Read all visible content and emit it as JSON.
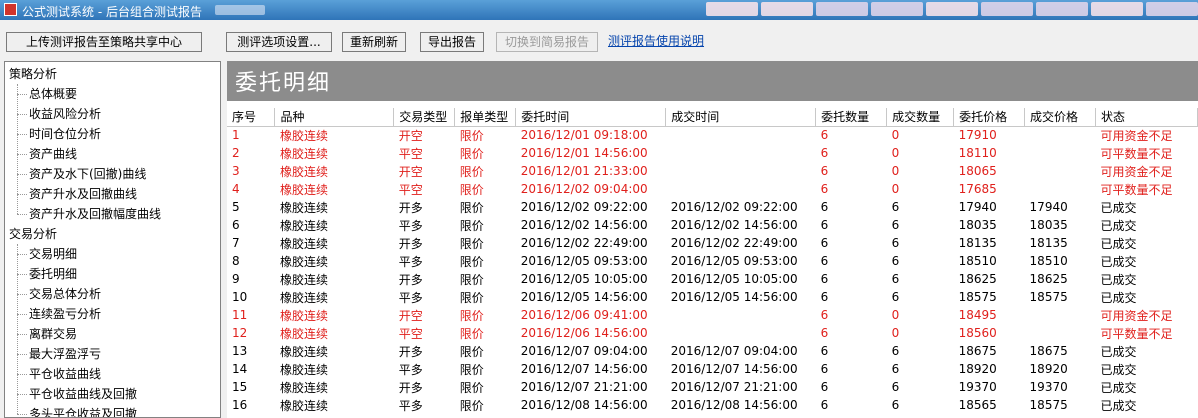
{
  "window": {
    "title": "公式测试系统 - 后台组合测试报告"
  },
  "toolbar": {
    "upload_label": "上传测评报告至策略共享中心",
    "options_label": "测评选项设置...",
    "refresh_label": "重新刷新",
    "export_label": "导出报告",
    "switch_label": "切换到简易报告",
    "help_link": "测评报告使用说明"
  },
  "sidebar": {
    "groups": [
      {
        "label": "策略分析",
        "items": [
          "总体概要",
          "收益风险分析",
          "时间仓位分析",
          "资产曲线",
          "资产及水下(回撤)曲线",
          "资产升水及回撤曲线",
          "资产升水及回撤幅度曲线"
        ]
      },
      {
        "label": "交易分析",
        "items": [
          "交易明细",
          "委托明细",
          "交易总体分析",
          "连续盈亏分析",
          "离群交易",
          "最大浮盈浮亏",
          "平仓收益曲线",
          "平仓收益曲线及回撤",
          "多头平仓收益及回撤"
        ]
      }
    ]
  },
  "main": {
    "heading": "委托明细",
    "columns": [
      "序号",
      "品种",
      "交易类型",
      "报单类型",
      "委托时间",
      "成交时间",
      "委托数量",
      "成交数量",
      "委托价格",
      "成交价格",
      "状态"
    ],
    "rows": [
      [
        "1",
        "橡胶连续",
        "开空",
        "限价",
        "2016/12/01 09:18:00",
        "",
        "6",
        "0",
        "17910",
        "",
        "可用资金不足"
      ],
      [
        "2",
        "橡胶连续",
        "平空",
        "限价",
        "2016/12/01 14:56:00",
        "",
        "6",
        "0",
        "18110",
        "",
        "可平数量不足"
      ],
      [
        "3",
        "橡胶连续",
        "开空",
        "限价",
        "2016/12/01 21:33:00",
        "",
        "6",
        "0",
        "18065",
        "",
        "可用资金不足"
      ],
      [
        "4",
        "橡胶连续",
        "平空",
        "限价",
        "2016/12/02 09:04:00",
        "",
        "6",
        "0",
        "17685",
        "",
        "可平数量不足"
      ],
      [
        "5",
        "橡胶连续",
        "开多",
        "限价",
        "2016/12/02 09:22:00",
        "2016/12/02 09:22:00",
        "6",
        "6",
        "17940",
        "17940",
        "已成交"
      ],
      [
        "6",
        "橡胶连续",
        "平多",
        "限价",
        "2016/12/02 14:56:00",
        "2016/12/02 14:56:00",
        "6",
        "6",
        "18035",
        "18035",
        "已成交"
      ],
      [
        "7",
        "橡胶连续",
        "开多",
        "限价",
        "2016/12/02 22:49:00",
        "2016/12/02 22:49:00",
        "6",
        "6",
        "18135",
        "18135",
        "已成交"
      ],
      [
        "8",
        "橡胶连续",
        "平多",
        "限价",
        "2016/12/05 09:53:00",
        "2016/12/05 09:53:00",
        "6",
        "6",
        "18510",
        "18510",
        "已成交"
      ],
      [
        "9",
        "橡胶连续",
        "开多",
        "限价",
        "2016/12/05 10:05:00",
        "2016/12/05 10:05:00",
        "6",
        "6",
        "18625",
        "18625",
        "已成交"
      ],
      [
        "10",
        "橡胶连续",
        "平多",
        "限价",
        "2016/12/05 14:56:00",
        "2016/12/05 14:56:00",
        "6",
        "6",
        "18575",
        "18575",
        "已成交"
      ],
      [
        "11",
        "橡胶连续",
        "开空",
        "限价",
        "2016/12/06 09:41:00",
        "",
        "6",
        "0",
        "18495",
        "",
        "可用资金不足"
      ],
      [
        "12",
        "橡胶连续",
        "平空",
        "限价",
        "2016/12/06 14:56:00",
        "",
        "6",
        "0",
        "18560",
        "",
        "可平数量不足"
      ],
      [
        "13",
        "橡胶连续",
        "开多",
        "限价",
        "2016/12/07 09:04:00",
        "2016/12/07 09:04:00",
        "6",
        "6",
        "18675",
        "18675",
        "已成交"
      ],
      [
        "14",
        "橡胶连续",
        "平多",
        "限价",
        "2016/12/07 14:56:00",
        "2016/12/07 14:56:00",
        "6",
        "6",
        "18920",
        "18920",
        "已成交"
      ],
      [
        "15",
        "橡胶连续",
        "开多",
        "限价",
        "2016/12/07 21:21:00",
        "2016/12/07 21:21:00",
        "6",
        "6",
        "19370",
        "19370",
        "已成交"
      ],
      [
        "16",
        "橡胶连续",
        "平多",
        "限价",
        "2016/12/08 14:56:00",
        "2016/12/08 14:56:00",
        "6",
        "6",
        "18565",
        "18575",
        "已成交"
      ]
    ],
    "red_row_indices": [
      0,
      1,
      2,
      3,
      10,
      11
    ]
  },
  "colors": {
    "error_text": "#e0201c",
    "header_bar": "#8c8c8c",
    "link": "#0645ad"
  }
}
